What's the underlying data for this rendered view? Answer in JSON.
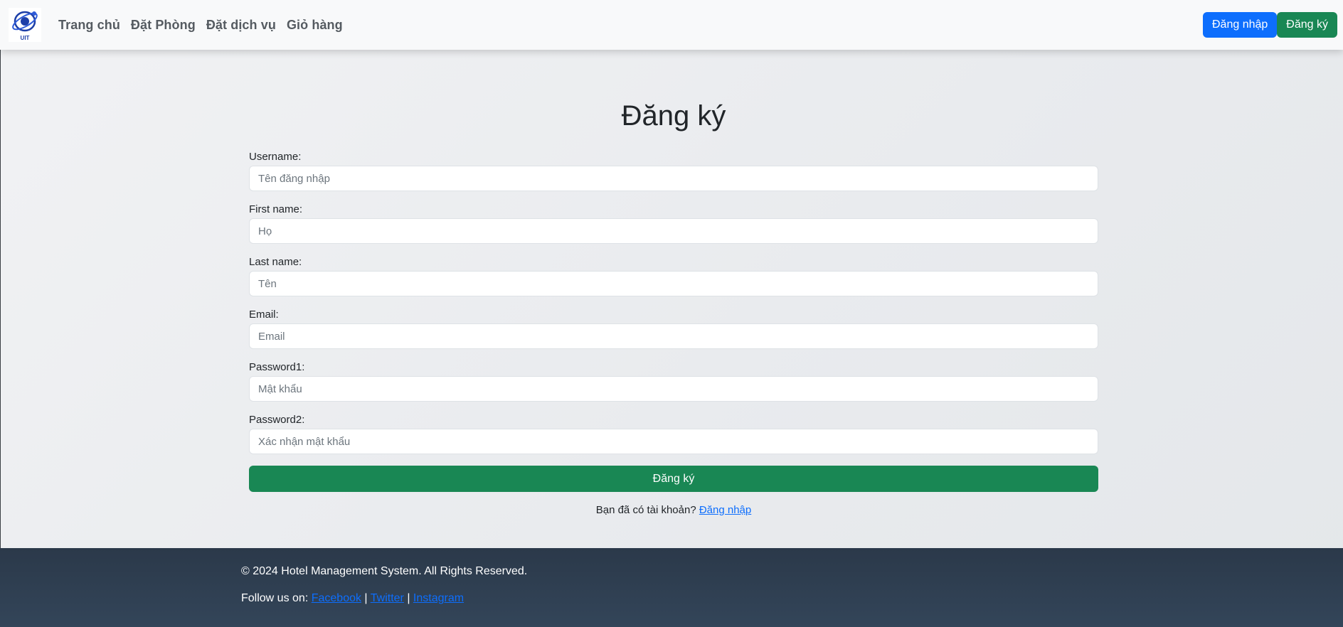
{
  "navbar": {
    "logo_text": "UIT",
    "links": [
      "Trang chủ",
      "Đặt Phòng",
      "Đặt dịch vụ",
      "Giỏ hàng"
    ],
    "login_label": "Đăng nhập",
    "register_label": "Đăng ký"
  },
  "form": {
    "title": "Đăng ký",
    "fields": [
      {
        "label": "Username:",
        "placeholder": "Tên đăng nhập"
      },
      {
        "label": "First name:",
        "placeholder": "Họ"
      },
      {
        "label": "Last name:",
        "placeholder": "Tên"
      },
      {
        "label": "Email:",
        "placeholder": "Email"
      },
      {
        "label": "Password1:",
        "placeholder": "Mật khẩu"
      },
      {
        "label": "Password2:",
        "placeholder": "Xác nhận mật khẩu"
      }
    ],
    "submit_label": "Đăng ký",
    "prompt_text": "Bạn đã có tài khoản? ",
    "prompt_link": "Đăng nhập"
  },
  "footer": {
    "copyright": "© 2024 Hotel Management System. All Rights Reserved.",
    "follow_text": "Follow us on: ",
    "social": [
      "Facebook",
      "Twitter",
      "Instagram"
    ],
    "separator": " | "
  },
  "colors": {
    "primary": "#0d6efd",
    "success": "#198754",
    "footer_bg": "#2b394a"
  }
}
